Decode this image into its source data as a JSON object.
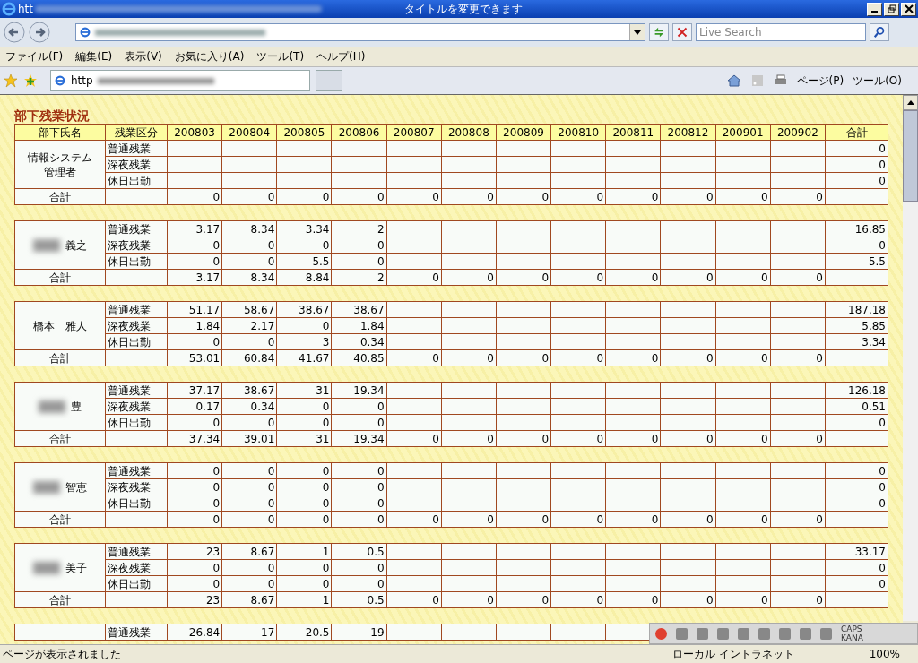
{
  "window": {
    "title_prefix": "htt",
    "title": "タイトルを変更できます"
  },
  "search": {
    "placeholder": "Live Search"
  },
  "menu": [
    "ファイル(F)",
    "編集(E)",
    "表示(V)",
    "お気に入り(A)",
    "ツール(T)",
    "ヘルプ(H)"
  ],
  "tab": {
    "label": "http"
  },
  "command_bar": [
    "ページ(P)",
    "ツール(O)"
  ],
  "page": {
    "title": "部下残業状況",
    "columns": [
      "部下氏名",
      "残業区分",
      "200803",
      "200804",
      "200805",
      "200806",
      "200807",
      "200808",
      "200809",
      "200810",
      "200811",
      "200812",
      "200901",
      "200902",
      "合計"
    ],
    "groups": [
      {
        "name_lines": [
          "情報システム",
          "管理者"
        ],
        "blurred": false,
        "rows": [
          {
            "label": "普通残業",
            "values": [],
            "total": "0"
          },
          {
            "label": "深夜残業",
            "values": [],
            "total": "0"
          },
          {
            "label": "休日出勤",
            "values": [],
            "total": "0"
          }
        ],
        "sum": {
          "label": "合計",
          "values": [
            "0",
            "0",
            "0",
            "0",
            "0",
            "0",
            "0",
            "0",
            "0",
            "0",
            "0",
            "0"
          ]
        }
      },
      {
        "name_lines": [
          "義之"
        ],
        "blurred": true,
        "rows": [
          {
            "label": "普通残業",
            "values": [
              "3.17",
              "8.34",
              "3.34",
              "2"
            ],
            "total": "16.85"
          },
          {
            "label": "深夜残業",
            "values": [
              "0",
              "0",
              "0",
              "0"
            ],
            "total": "0"
          },
          {
            "label": "休日出勤",
            "values": [
              "0",
              "0",
              "5.5",
              "0"
            ],
            "total": "5.5"
          }
        ],
        "sum": {
          "label": "合計",
          "values": [
            "3.17",
            "8.34",
            "8.84",
            "2",
            "0",
            "0",
            "0",
            "0",
            "0",
            "0",
            "0",
            "0"
          ]
        }
      },
      {
        "name_lines": [
          "橋本　雅人"
        ],
        "blurred": false,
        "rows": [
          {
            "label": "普通残業",
            "values": [
              "51.17",
              "58.67",
              "38.67",
              "38.67"
            ],
            "total": "187.18"
          },
          {
            "label": "深夜残業",
            "values": [
              "1.84",
              "2.17",
              "0",
              "1.84"
            ],
            "total": "5.85"
          },
          {
            "label": "休日出勤",
            "values": [
              "0",
              "0",
              "3",
              "0.34"
            ],
            "total": "3.34"
          }
        ],
        "sum": {
          "label": "合計",
          "values": [
            "53.01",
            "60.84",
            "41.67",
            "40.85",
            "0",
            "0",
            "0",
            "0",
            "0",
            "0",
            "0",
            "0"
          ]
        }
      },
      {
        "name_lines": [
          "豊"
        ],
        "blurred": true,
        "rows": [
          {
            "label": "普通残業",
            "values": [
              "37.17",
              "38.67",
              "31",
              "19.34"
            ],
            "total": "126.18"
          },
          {
            "label": "深夜残業",
            "values": [
              "0.17",
              "0.34",
              "0",
              "0"
            ],
            "total": "0.51"
          },
          {
            "label": "休日出勤",
            "values": [
              "0",
              "0",
              "0",
              "0"
            ],
            "total": "0"
          }
        ],
        "sum": {
          "label": "合計",
          "values": [
            "37.34",
            "39.01",
            "31",
            "19.34",
            "0",
            "0",
            "0",
            "0",
            "0",
            "0",
            "0",
            "0"
          ]
        }
      },
      {
        "name_lines": [
          "智恵"
        ],
        "blurred": true,
        "rows": [
          {
            "label": "普通残業",
            "values": [
              "0",
              "0",
              "0",
              "0"
            ],
            "total": "0"
          },
          {
            "label": "深夜残業",
            "values": [
              "0",
              "0",
              "0",
              "0"
            ],
            "total": "0"
          },
          {
            "label": "休日出勤",
            "values": [
              "0",
              "0",
              "0",
              "0"
            ],
            "total": "0"
          }
        ],
        "sum": {
          "label": "合計",
          "values": [
            "0",
            "0",
            "0",
            "0",
            "0",
            "0",
            "0",
            "0",
            "0",
            "0",
            "0",
            "0"
          ]
        }
      },
      {
        "name_lines": [
          "美子"
        ],
        "blurred": true,
        "rows": [
          {
            "label": "普通残業",
            "values": [
              "23",
              "8.67",
              "1",
              "0.5"
            ],
            "total": "33.17"
          },
          {
            "label": "深夜残業",
            "values": [
              "0",
              "0",
              "0",
              "0"
            ],
            "total": "0"
          },
          {
            "label": "休日出勤",
            "values": [
              "0",
              "0",
              "0",
              "0"
            ],
            "total": "0"
          }
        ],
        "sum": {
          "label": "合計",
          "values": [
            "23",
            "8.67",
            "1",
            "0.5",
            "0",
            "0",
            "0",
            "0",
            "0",
            "0",
            "0",
            "0"
          ]
        }
      },
      {
        "rows": [
          {
            "label": "普通残業",
            "values": [
              "26.84",
              "17",
              "20.5",
              "19"
            ]
          }
        ]
      }
    ]
  },
  "language_bar": {
    "caps": "CAPS",
    "kana": "KANA"
  },
  "status_bar": {
    "text": "ページが表示されました",
    "zone": "ローカル イントラネット",
    "zoom": "100%"
  }
}
